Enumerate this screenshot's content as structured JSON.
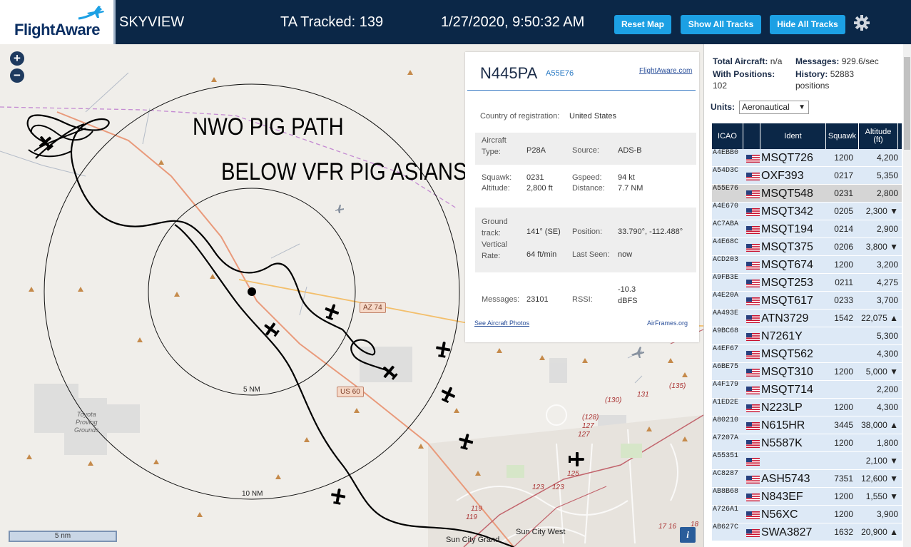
{
  "header": {
    "logo_text": "FlightAware",
    "app_title": "SKYVIEW",
    "tracked": "TA Tracked: 139",
    "datetime": "1/27/2020, 9:50:32 AM",
    "buttons": [
      "Reset Map",
      "Show All Tracks",
      "Hide All Tracks"
    ]
  },
  "map": {
    "zoom_in": "+",
    "zoom_out": "−",
    "overlay_line1": "NWO PIG PATH",
    "overlay_line2": "BELOW VFR PIG ASIANS",
    "ring_labels": [
      "5 NM",
      "10 NM"
    ],
    "road_shields": [
      "AZ 74",
      "US 60"
    ],
    "place_labels": [
      "Toyota\nProving\nGrounds",
      "Sun City West",
      "Sun City Grand"
    ],
    "route_numbers": [
      "(130)",
      "131",
      "(135)",
      "(128)",
      "127",
      "127",
      "125",
      "123",
      "123",
      "119",
      "119",
      "17",
      "16",
      "18"
    ],
    "scale_label": "5 nm",
    "info_button": "i"
  },
  "popup": {
    "callsign": "N445PA",
    "hex": "A55E76",
    "fa_link": "FlightAware.com",
    "country_label": "Country of registration:",
    "country_value": "United States",
    "fields": {
      "aircraft_type_label": "Aircraft Type:",
      "aircraft_type_value": "P28A",
      "source_label": "Source:",
      "source_value": "ADS-B",
      "squawk_label": "Squawk:",
      "squawk_value": "0231",
      "gspeed_label": "Gspeed:",
      "gspeed_value": "94 kt",
      "altitude_label": "Altitude:",
      "altitude_value": "2,800 ft",
      "distance_label": "Distance:",
      "distance_value": "7.7 NM",
      "ground_track_label": "Ground track:",
      "ground_track_value": "141° (SE)",
      "position_label": "Position:",
      "position_value": "33.790°, -112.488°",
      "vertical_rate_label": "Vertical Rate:",
      "vertical_rate_value": "64 ft/min",
      "last_seen_label": "Last Seen:",
      "last_seen_value": "now",
      "messages_label": "Messages:",
      "messages_value": "23101",
      "rssi_label": "RSSI:",
      "rssi_value": "-10.3 dBFS"
    },
    "photos_link": "See Aircraft Photos",
    "airframes_link": "AirFrames.org"
  },
  "sidebar": {
    "total_aircraft_label": "Total Aircraft:",
    "total_aircraft_value": "n/a",
    "messages_label": "Messages:",
    "messages_value": "929.6/sec",
    "with_positions_label": "With Positions:",
    "with_positions_value": "102",
    "history_label": "History:",
    "history_value": "52883 positions",
    "units_label": "Units:",
    "units_value": "Aeronautical",
    "columns": [
      "ICAO",
      "",
      "Ident",
      "Squawk",
      "Altitude (ft)"
    ],
    "rows": [
      {
        "icao": "A4EBB0",
        "ident": "MSQT726",
        "squawk": "1200",
        "alt": "4,200",
        "sel": false
      },
      {
        "icao": "A54D3C",
        "ident": "OXF393",
        "squawk": "0217",
        "alt": "5,350",
        "sel": false
      },
      {
        "icao": "A55E76",
        "ident": "MSQT548",
        "squawk": "0231",
        "alt": "2,800",
        "sel": true
      },
      {
        "icao": "A4E670",
        "ident": "MSQT342",
        "squawk": "0205",
        "alt": "2,300 ▼",
        "sel": false
      },
      {
        "icao": "AC7ABA",
        "ident": "MSQT194",
        "squawk": "0214",
        "alt": "2,900",
        "sel": false
      },
      {
        "icao": "A4E68C",
        "ident": "MSQT375",
        "squawk": "0206",
        "alt": "3,800 ▼",
        "sel": false
      },
      {
        "icao": "ACD203",
        "ident": "MSQT674",
        "squawk": "1200",
        "alt": "3,200",
        "sel": false
      },
      {
        "icao": "A9FB3E",
        "ident": "MSQT253",
        "squawk": "0211",
        "alt": "4,275",
        "sel": false
      },
      {
        "icao": "A4E20A",
        "ident": "MSQT617",
        "squawk": "0233",
        "alt": "3,700",
        "sel": false
      },
      {
        "icao": "AA493E",
        "ident": "ATN3729",
        "squawk": "1542",
        "alt": "22,075 ▲",
        "sel": false
      },
      {
        "icao": "A9BC68",
        "ident": "N7261Y",
        "squawk": "",
        "alt": "5,300",
        "sel": false
      },
      {
        "icao": "A4EF67",
        "ident": "MSQT562",
        "squawk": "",
        "alt": "4,300",
        "sel": false
      },
      {
        "icao": "A6BE75",
        "ident": "MSQT310",
        "squawk": "1200",
        "alt": "5,000 ▼",
        "sel": false
      },
      {
        "icao": "A4F179",
        "ident": "MSQT714",
        "squawk": "",
        "alt": "2,200",
        "sel": false
      },
      {
        "icao": "A1ED2E",
        "ident": "N223LP",
        "squawk": "1200",
        "alt": "4,300",
        "sel": false
      },
      {
        "icao": "A80210",
        "ident": "N615HR",
        "squawk": "3445",
        "alt": "38,000 ▲",
        "sel": false
      },
      {
        "icao": "A7207A",
        "ident": "N5587K",
        "squawk": "1200",
        "alt": "1,800",
        "sel": false
      },
      {
        "icao": "A55351",
        "ident": "",
        "squawk": "",
        "alt": "2,100 ▼",
        "sel": false
      },
      {
        "icao": "AC8287",
        "ident": "ASH5743",
        "squawk": "7351",
        "alt": "12,600 ▼",
        "sel": false
      },
      {
        "icao": "AB8B68",
        "ident": "N843EF",
        "squawk": "1200",
        "alt": "1,550 ▼",
        "sel": false
      },
      {
        "icao": "A726A1",
        "ident": "N56XC",
        "squawk": "1200",
        "alt": "3,900",
        "sel": false
      },
      {
        "icao": "AB627C",
        "ident": "SWA3827",
        "squawk": "1632",
        "alt": "20,900 ▲",
        "sel": false
      }
    ]
  },
  "colors": {
    "header_bg": "#0b2747",
    "button": "#1ca0e4",
    "table_row": "#dde9f6",
    "table_row_selected": "#d5d5d5"
  }
}
